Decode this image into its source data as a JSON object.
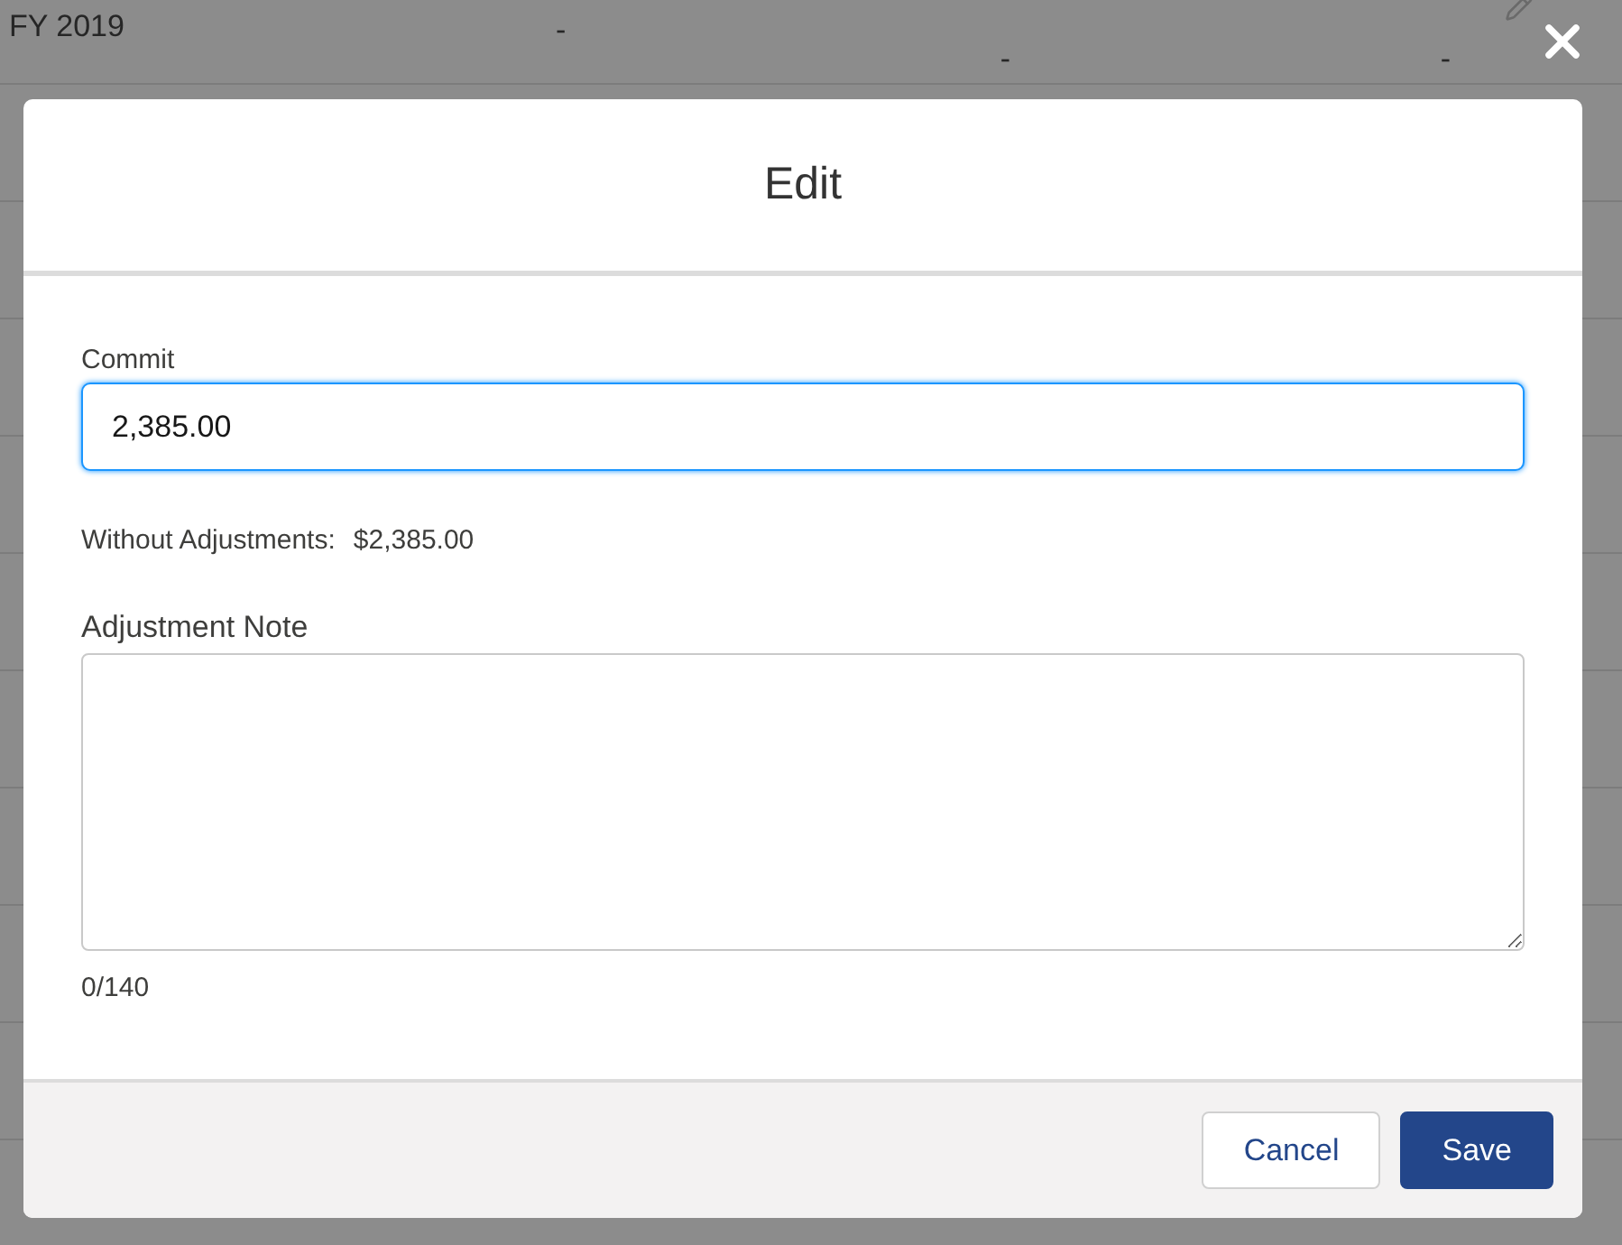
{
  "background_table": {
    "rows": [
      {
        "column_1": "FY 2019",
        "column_2": "-",
        "column_3": "-",
        "column_4": "-",
        "editable": true
      },
      {},
      {},
      {},
      {},
      {},
      {},
      {},
      {},
      {},
      {}
    ]
  },
  "modal": {
    "title": "Edit",
    "commit": {
      "label": "Commit",
      "value": "2,385.00"
    },
    "without_adjustments": {
      "label": "Without Adjustments:",
      "value": "$2,385.00"
    },
    "adjustment_note": {
      "label": "Adjustment Note",
      "counter": "0/140"
    },
    "buttons": [
      {
        "label": "Cancel",
        "kind": "neutral"
      },
      {
        "label": "Save",
        "kind": "brand"
      }
    ]
  }
}
